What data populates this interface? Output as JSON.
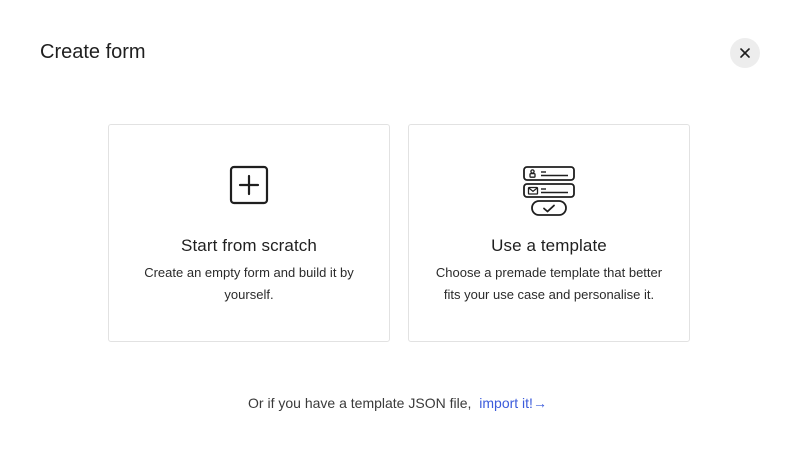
{
  "dialog": {
    "title": "Create form",
    "close_icon": "close-icon"
  },
  "options": [
    {
      "title": "Start from scratch",
      "description": "Create an empty form and build it by yourself.",
      "icon": "plus-square-icon"
    },
    {
      "title": "Use a template",
      "description": "Choose a premade template that better fits your use case and personalise it.",
      "icon": "template-form-icon"
    }
  ],
  "footer": {
    "text": "Or if you have a template JSON file,",
    "link_label": "import it!",
    "link_arrow": "→"
  },
  "colors": {
    "link": "#3b5bdb",
    "card_border": "#e2e2e2",
    "close_bg": "#ededed"
  }
}
